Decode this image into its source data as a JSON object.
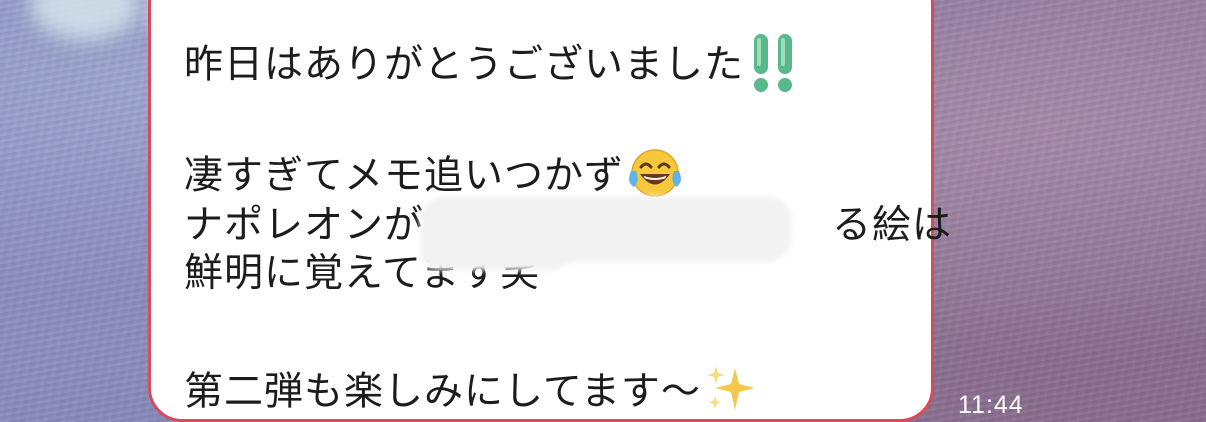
{
  "chat": {
    "message": {
      "line1": "昨日はありがとうございました",
      "line2": "凄すぎてメモ追いつかず",
      "line3_start": "ナポレオンが",
      "line3_end": "る絵は",
      "line4": "鮮明に覚えてます笑",
      "line5": "第二弾も楽しみにしてます〜",
      "emoji_1": "double-exclamation-icon",
      "emoji_2": "tears-of-joy-icon",
      "emoji_3": "sparkles-icon"
    },
    "timestamp": "11:44"
  },
  "colors": {
    "bubble_border": "#d64c5a",
    "exclamation_green": "#59b98a",
    "sparkle_yellow": "#f2c94c"
  }
}
